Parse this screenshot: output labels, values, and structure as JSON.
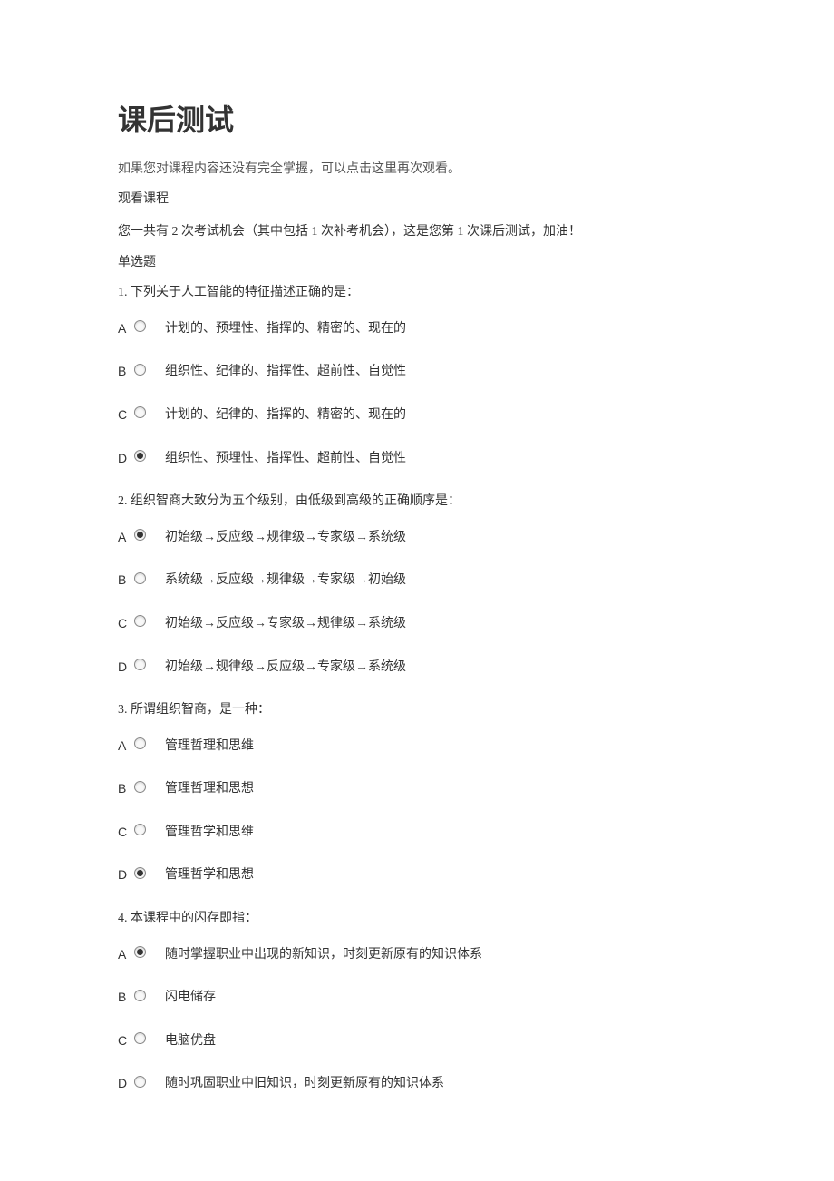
{
  "title": "课后测试",
  "intro": "如果您对课程内容还没有完全掌握，可以点击这里再次观看。",
  "watch_course": "观看课程",
  "attempt_info": "您一共有 2 次考试机会（其中包括 1 次补考机会），这是您第 1 次课后测试，加油！",
  "section_type": "单选题",
  "questions": [
    {
      "number": "1.",
      "text": "下列关于人工智能的特征描述正确的是：",
      "options": [
        {
          "letter": "A",
          "text": "计划的、预埋性、指挥的、精密的、现在的",
          "selected": false
        },
        {
          "letter": "B",
          "text": "组织性、纪律的、指挥性、超前性、自觉性",
          "selected": false
        },
        {
          "letter": "C",
          "text": "计划的、纪律的、指挥的、精密的、现在的",
          "selected": false
        },
        {
          "letter": "D",
          "text": "组织性、预埋性、指挥性、超前性、自觉性",
          "selected": true
        }
      ]
    },
    {
      "number": "2.",
      "text": "组织智商大致分为五个级别，由低级到高级的正确顺序是：",
      "options": [
        {
          "letter": "A",
          "text": "初始级→反应级→规律级→专家级→系统级",
          "selected": true
        },
        {
          "letter": "B",
          "text": "系统级→反应级→规律级→专家级→初始级",
          "selected": false
        },
        {
          "letter": "C",
          "text": "初始级→反应级→专家级→规律级→系统级",
          "selected": false
        },
        {
          "letter": "D",
          "text": "初始级→规律级→反应级→专家级→系统级",
          "selected": false
        }
      ]
    },
    {
      "number": "3.",
      "text": "所谓组织智商，是一种：",
      "options": [
        {
          "letter": "A",
          "text": "管理哲理和思维",
          "selected": false
        },
        {
          "letter": "B",
          "text": "管理哲理和思想",
          "selected": false
        },
        {
          "letter": "C",
          "text": "管理哲学和思维",
          "selected": false
        },
        {
          "letter": "D",
          "text": "管理哲学和思想",
          "selected": true
        }
      ]
    },
    {
      "number": "4.",
      "text": "本课程中的闪存即指：",
      "options": [
        {
          "letter": "A",
          "text": "随时掌握职业中出现的新知识，时刻更新原有的知识体系",
          "selected": true
        },
        {
          "letter": "B",
          "text": "闪电储存",
          "selected": false
        },
        {
          "letter": "C",
          "text": "电脑优盘",
          "selected": false
        },
        {
          "letter": "D",
          "text": "随时巩固职业中旧知识，时刻更新原有的知识体系",
          "selected": false
        }
      ]
    }
  ]
}
